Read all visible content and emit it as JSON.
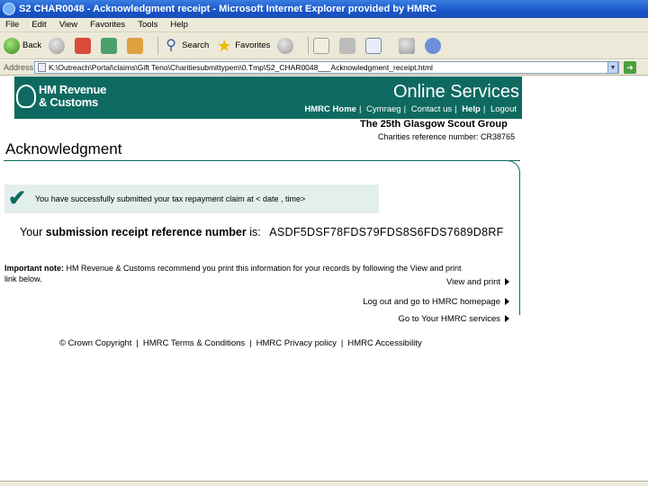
{
  "window": {
    "title": "S2 CHAR0048 - Acknowledgment receipt - Microsoft Internet Explorer provided by HMRC"
  },
  "menu": [
    "File",
    "Edit",
    "View",
    "Favorites",
    "Tools",
    "Help"
  ],
  "toolbar": {
    "back": "Back",
    "search": "Search",
    "favorites": "Favorites"
  },
  "address": {
    "label": "Address",
    "url": "K:\\Outreach\\Portal\\claims\\Gift Teno\\Charitiesubmittypem\\0.Tmp\\S2_CHAR0048___Acknowledgment_receipt.html"
  },
  "banner": {
    "logo_line1": "HM Revenue",
    "logo_line2": "& Customs",
    "title": "Online Services",
    "nav": [
      "HMRC Home",
      "Cymraeg",
      "Contact us",
      "Help",
      "Logout"
    ]
  },
  "org": {
    "name": "The 25th Glasgow Scout Group",
    "charity_ref": "Charities reference number: CR38765"
  },
  "page": {
    "heading": "Acknowledgment",
    "success_message": "You have successfully submitted your tax repayment claim at < date , time>",
    "receipt_label_a": "Your",
    "receipt_label_b": "submission receipt reference number",
    "receipt_label_c": " is:",
    "receipt_ref": "ASDF5DSF78FDS79FDS8S6FDS7689D8RF",
    "note_bold": "Important note:",
    "note_text": " HM Revenue & Customs recommend you print this information for your records by following the View and print link below."
  },
  "links": {
    "view_print": "View and print",
    "logout_home": "Log out and go to HMRC homepage",
    "go_services": "Go to Your HMRC services"
  },
  "footer": {
    "copyright": "© Crown Copyright",
    "terms": "HMRC Terms & Conditions",
    "privacy": "HMRC Privacy policy",
    "accessibility": "HMRC Accessibility"
  }
}
